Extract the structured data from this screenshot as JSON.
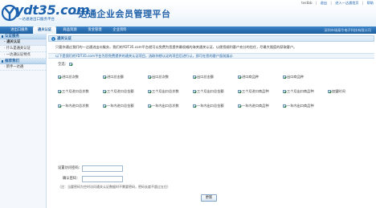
{
  "brand": {
    "logo_text": "ydt35.com",
    "slogan": "一达通进出口服务平台",
    "platform_title": "一达通企业会员管理平台"
  },
  "top_links": {
    "user": "testbb",
    "logout": "退出",
    "portal": "进入一达通首页",
    "help": "帮助"
  },
  "nav": {
    "tabs": [
      {
        "label": "进出口服务"
      },
      {
        "label": "通关认证"
      },
      {
        "label": "商品资源"
      },
      {
        "label": "资金管理"
      },
      {
        "label": "企业资料"
      }
    ],
    "active_index": 1,
    "company": "深圳市瑞泰华电子科技有限公司"
  },
  "sidebar": {
    "sections": [
      {
        "title": "认证服务",
        "items": [
          {
            "label": "· 通关认证"
          },
          {
            "label": "· 什么是通关认证"
          },
          {
            "label": "· 一达通认证特点"
          }
        ]
      },
      {
        "title": "推荐我们",
        "items": [
          {
            "label": "· 新手一达通"
          }
        ]
      }
    ]
  },
  "panel": {
    "title": "通关认证",
    "intro": "只要你通过我们的一达通进出口服务，我们的YDT35.com平台就可以免费为您提供最权威的海关通关认证，以便您顺利客户充分的信任，尽最大限度的获取客户。",
    "notice": "以下是我们的YDT35.com平台为您免费提供的通关认证项目，选取你想认证的项目后进行认，即可在您的客户面前展示",
    "select_all": "全选："
  },
  "options": [
    [
      "进口总次数",
      "进口总金额",
      "出口总次数",
      "出口总金额",
      "进口商品种",
      "出口商品种"
    ],
    [
      "三个月进口总次数",
      "三个月进口总金额",
      "三个月出口总次数",
      "三个月出口总金额",
      "三个月进口商品种",
      "三个月出口商品种",
      "加盟时间"
    ],
    [
      "一年内进口总次数",
      "一年内进口总金额",
      "一年内出口总次数",
      "一年内出口总金额",
      "一年内进口商品种",
      "一年内出口商品种"
    ]
  ],
  "form": {
    "password_label": "设置访问密码：",
    "confirm_label": "确认密码：",
    "hint": "（注：当要密码为空时访问通关认证数据时不需要密码，密码长度不超过五位）",
    "submit_label": "更新"
  },
  "colors": {
    "brand_blue": "#1c62ae",
    "nav_blue": "#2a6fb5"
  }
}
